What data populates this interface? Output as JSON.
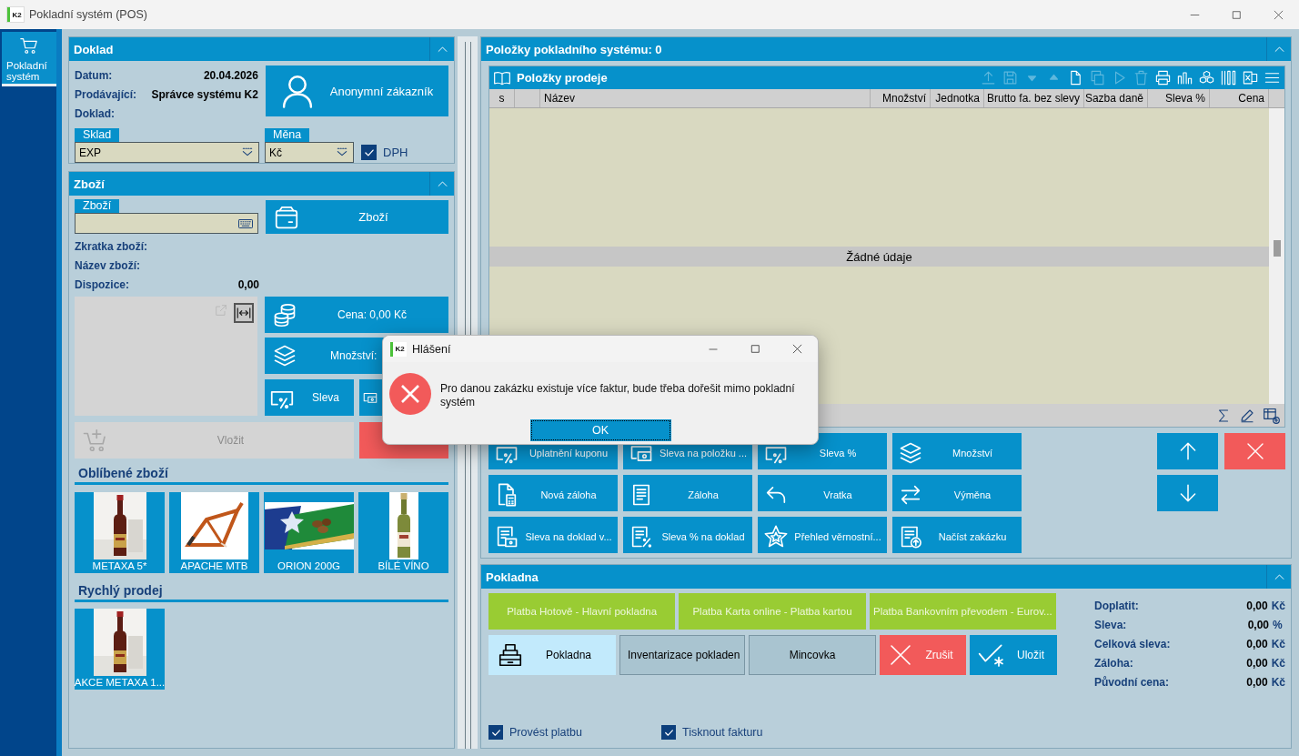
{
  "window": {
    "logo": "K2",
    "title": "Pokladní systém (POS)"
  },
  "nav": [
    {
      "label": "Pokladní systém",
      "selected": true
    }
  ],
  "doklad": {
    "title": "Doklad",
    "info": [
      {
        "label": "Datum:",
        "value": "20.04.2026"
      },
      {
        "label": "Prodávající:",
        "value": "Správce systému K2"
      },
      {
        "label": "Doklad:"
      }
    ],
    "customer_button": "Anonymní zákazník",
    "fields": [
      {
        "label": "Sklad",
        "value": "EXP"
      },
      {
        "label": "Měna",
        "value": "Kč"
      }
    ],
    "vat": {
      "label": "DPH",
      "checked": true
    }
  },
  "goods": {
    "title": "Zboží",
    "field_label": "Zboží",
    "goods_button": "Zboží",
    "info": [
      {
        "label": "Zkratka zboží:"
      },
      {
        "label": "Název zboží:"
      },
      {
        "label": "Dispozice:",
        "value": "0,00"
      }
    ],
    "price_button": "Cena: 0,00 Kč",
    "quantity_button": "Množství:",
    "discount_button": "Sleva",
    "insert_button": {
      "label": "Vložit",
      "disabled": true
    },
    "favorites": {
      "title": "Oblíbené zboží",
      "items": [
        {
          "label": "METAXA 5*"
        },
        {
          "label": "APACHE MTB"
        },
        {
          "label": "ORION 200G"
        },
        {
          "label": "BÍLÉ VÍNO"
        }
      ]
    },
    "quick_sale": {
      "title": "Rychlý prodej",
      "items": [
        {
          "label": "AKCE METAXA 1..."
        }
      ]
    }
  },
  "items_panel": {
    "title": "Položky pokladního systému: 0",
    "table": {
      "title": "Položky prodeje",
      "columns": [
        "s",
        "Název",
        "Množství",
        "Jednotka",
        "Brutto fa. bez slevy",
        "Sazba daně",
        "Sleva %",
        "Cena"
      ],
      "empty_message": "Žádné údaje"
    },
    "actions": [
      "Uplatnění kuponu",
      "Sleva na položku ...",
      "Sleva %",
      "Množství",
      "Nová záloha",
      "Záloha",
      "Vratka",
      "Výměna",
      "Sleva na doklad v...",
      "Sleva % na doklad",
      "Přehled věrnostní...",
      "Načíst zakázku"
    ]
  },
  "pokladna": {
    "title": "Pokladna",
    "payments": [
      "Platba Hotově - Hlavní pokladna",
      "Platba Karta online - Platba kartou",
      "Platba Bankovním převodem - Eurov..."
    ],
    "buttons": [
      {
        "label": "Pokladna",
        "kind": "register",
        "selected": true
      },
      {
        "label": "Inventarizace pokladen",
        "kind": "plain",
        "selected": false
      },
      {
        "label": "Mincovka",
        "kind": "plain",
        "selected": false
      },
      {
        "label": "Zrušit",
        "kind": "cancel",
        "selected": false
      },
      {
        "label": "Uložit",
        "kind": "save",
        "selected": false
      }
    ],
    "summary": [
      {
        "label": "Doplatit:",
        "value": "0,00",
        "unit": "Kč"
      },
      {
        "label": "Sleva:",
        "value": "0,00",
        "unit": "%"
      },
      {
        "label": "Celková sleva:",
        "value": "0,00",
        "unit": "Kč"
      },
      {
        "label": "Záloha:",
        "value": "0,00",
        "unit": "Kč"
      },
      {
        "label": "Původní cena:",
        "value": "0,00",
        "unit": "Kč"
      }
    ],
    "options": [
      {
        "label": "Provést platbu",
        "checked": true
      },
      {
        "label": "Tisknout fakturu",
        "checked": true
      }
    ]
  },
  "dialog": {
    "logo": "K2",
    "title": "Hlášení",
    "message": "Pro danou zakázku existuje více faktur, bude třeba dořešit mimo pokladní systém",
    "ok_button": "OK"
  }
}
